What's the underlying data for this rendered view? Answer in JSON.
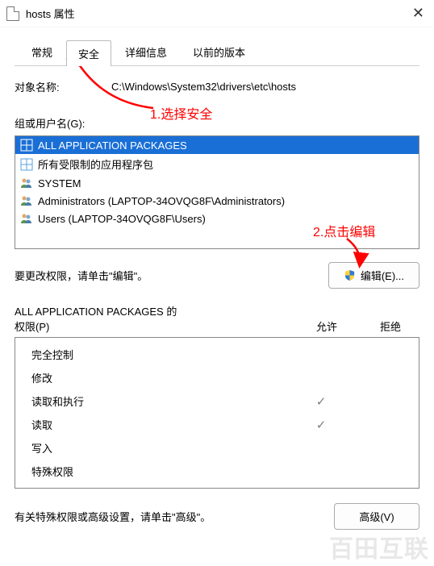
{
  "window": {
    "title": "hosts 属性",
    "close_glyph": "✕"
  },
  "tabs": {
    "general": "常规",
    "security": "安全",
    "details": "详细信息",
    "previous": "以前的版本"
  },
  "object": {
    "label": "对象名称:",
    "path": "C:\\Windows\\System32\\drivers\\etc\\hosts"
  },
  "groups": {
    "label": "组或用户名(G):",
    "items": [
      "ALL APPLICATION PACKAGES",
      "所有受限制的应用程序包",
      "SYSTEM",
      "Administrators (LAPTOP-34OVQG8F\\Administrators)",
      "Users (LAPTOP-34OVQG8F\\Users)"
    ]
  },
  "edit": {
    "prompt": "要更改权限，请单击\"编辑\"。",
    "button": "编辑(E)..."
  },
  "perm_header": {
    "line1": "ALL APPLICATION PACKAGES 的",
    "line2": "权限(P)",
    "allow": "允许",
    "deny": "拒绝"
  },
  "perms": [
    {
      "name": "完全控制",
      "allow": false,
      "deny": false
    },
    {
      "name": "修改",
      "allow": false,
      "deny": false
    },
    {
      "name": "读取和执行",
      "allow": true,
      "deny": false
    },
    {
      "name": "读取",
      "allow": true,
      "deny": false
    },
    {
      "name": "写入",
      "allow": false,
      "deny": false
    },
    {
      "name": "特殊权限",
      "allow": false,
      "deny": false
    }
  ],
  "advanced": {
    "prompt": "有关特殊权限或高级设置，请单击\"高级\"。",
    "button": "高级(V)"
  },
  "annotations": {
    "step1": "1.选择安全",
    "step2": "2.点击编辑"
  },
  "watermark": "百田互联"
}
